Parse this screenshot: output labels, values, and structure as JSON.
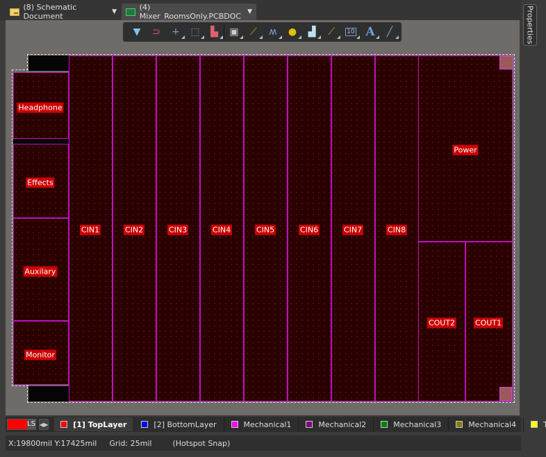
{
  "tabs": [
    {
      "label": "(8) Schematic Document",
      "icon": "schematic-doc-icon",
      "active": false
    },
    {
      "label": "(4) Mixer_RoomsOnly.PCBDOC",
      "icon": "pcb-doc-icon",
      "active": true
    }
  ],
  "right_panel": {
    "properties_label": "Properties"
  },
  "toolbar": [
    {
      "name": "filter-icon",
      "glyph": "▼",
      "color": "#7fc4e8"
    },
    {
      "name": "snap-magnet-icon",
      "glyph": "⊃",
      "color": "#e05c7c"
    },
    {
      "name": "crosshair-icon",
      "glyph": "+",
      "color": "#6fa0e0"
    },
    {
      "name": "select-rect-icon",
      "glyph": "⬚",
      "color": "#6fa0e0"
    },
    {
      "name": "align-icon",
      "glyph": "▙",
      "color": "#e06070"
    },
    {
      "name": "component-icon",
      "glyph": "▣",
      "color": "#cccccc"
    },
    {
      "name": "route-track-icon",
      "glyph": "⟋",
      "color": "#d0a030"
    },
    {
      "name": "diff-pair-icon",
      "glyph": "ʍ",
      "color": "#6fa0e0"
    },
    {
      "name": "via-icon",
      "glyph": "●",
      "color": "#e0c000"
    },
    {
      "name": "polygon-icon",
      "glyph": "▟",
      "color": "#bfe0f0"
    },
    {
      "name": "line-icon",
      "glyph": "⟋",
      "color": "#d0a030"
    },
    {
      "name": "dimension-icon",
      "glyph": "10",
      "color": "#bbbbbb"
    },
    {
      "name": "text-icon",
      "glyph": "A",
      "color": "#6fa0e0"
    },
    {
      "name": "draw-line-icon",
      "glyph": "╱",
      "color": "#6fa0e0"
    }
  ],
  "rooms": {
    "left": [
      "Headphone",
      "Effects",
      "Auxilary",
      "Monitor"
    ],
    "channels": [
      "CIN1",
      "CIN2",
      "CIN3",
      "CIN4",
      "CIN5",
      "CIN6",
      "CIN7",
      "CIN8"
    ],
    "power": "Power",
    "outputs": [
      "COUT2",
      "COUT1"
    ]
  },
  "layer_bar": {
    "ls_label": "LS",
    "ls_color": "#ff0000",
    "layers": [
      {
        "label": "[1] TopLayer",
        "color": "#ff0000",
        "active": true
      },
      {
        "label": "[2] BottomLayer",
        "color": "#0000ff",
        "active": false
      },
      {
        "label": "Mechanical1",
        "color": "#ff00ff",
        "active": false
      },
      {
        "label": "Mechanical2",
        "color": "#800080",
        "active": false
      },
      {
        "label": "Mechanical3",
        "color": "#008000",
        "active": false
      },
      {
        "label": "Mechanical4",
        "color": "#808000",
        "active": false
      },
      {
        "label": "Top Over",
        "color": "#ffff00",
        "active": false
      }
    ]
  },
  "status": {
    "coords": "X:19800mil Y:17425mil",
    "grid": "Grid: 25mil",
    "snap": "(Hotspot Snap)"
  }
}
